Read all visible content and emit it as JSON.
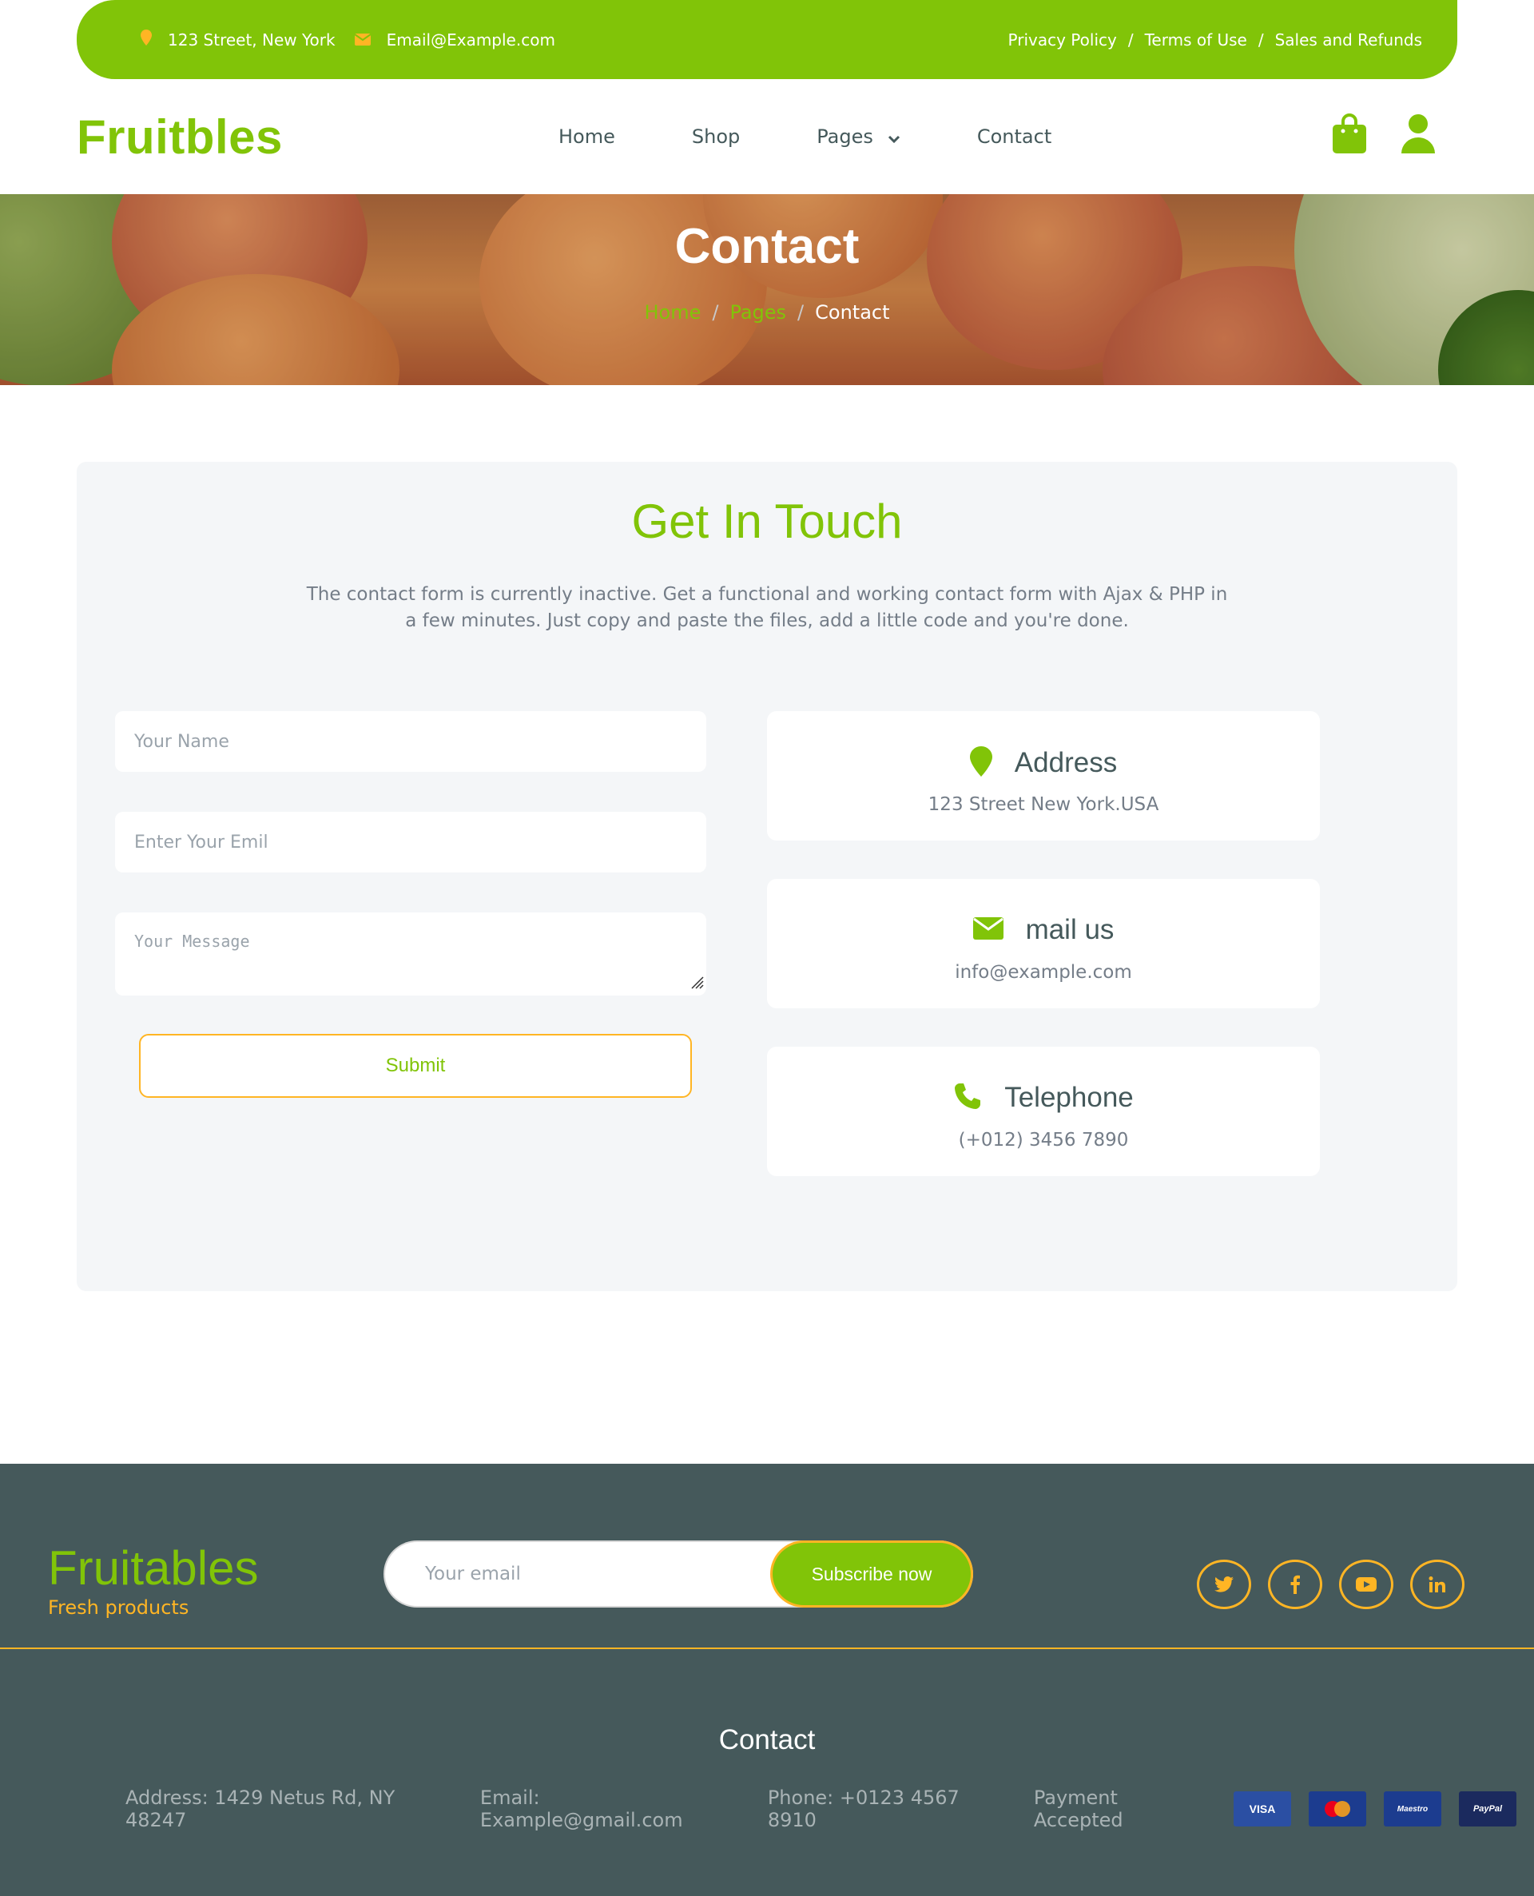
{
  "topbar": {
    "address": "123 Street, New York",
    "email": "Email@Example.com",
    "links": [
      "Privacy Policy",
      "Terms of Use",
      "Sales and Refunds"
    ],
    "separator": "/"
  },
  "navbar": {
    "brand": "Fruitbles",
    "links": [
      "Home",
      "Shop",
      "Pages",
      "Contact"
    ]
  },
  "hero": {
    "title": "Contact",
    "breadcrumb": [
      "Home",
      "Pages",
      "Contact"
    ],
    "separator": "/"
  },
  "contact": {
    "title": "Get In Touch",
    "description": "The contact form is currently inactive. Get a functional and working contact form with Ajax & PHP in a few minutes. Just copy and paste the files, add a little code and you're done.",
    "form": {
      "name_placeholder": "Your Name",
      "email_placeholder": "Enter Your Emil",
      "message_placeholder": "Your Message",
      "submit_label": "Submit"
    },
    "cards": [
      {
        "icon": "map-marker-icon",
        "label": "Address",
        "value": "123 Street New York.USA"
      },
      {
        "icon": "envelope-icon",
        "label": "mail us",
        "value": "info@example.com"
      },
      {
        "icon": "phone-icon",
        "label": "Telephone",
        "value": "(+012) 3456 7890"
      }
    ]
  },
  "footer": {
    "brand": "Fruitables",
    "tagline": "Fresh products",
    "subscribe": {
      "placeholder": "Your email",
      "button": "Subscribe now"
    },
    "socials": [
      "twitter-icon",
      "facebook-icon",
      "youtube-icon",
      "linkedin-icon"
    ],
    "contact_title": "Contact",
    "address": "Address: 1429 Netus Rd, NY 48247",
    "email": "Email: Example@gmail.com",
    "phone": "Phone: +0123 4567 8910",
    "payment_label": "Payment Accepted",
    "payment_cards": [
      "VISA",
      "MasterCard",
      "Maestro",
      "PayPal"
    ]
  },
  "colors": {
    "primary": "#81c408",
    "secondary": "#ffb524",
    "dark": "#45595b",
    "light": "#f4f6f8"
  }
}
